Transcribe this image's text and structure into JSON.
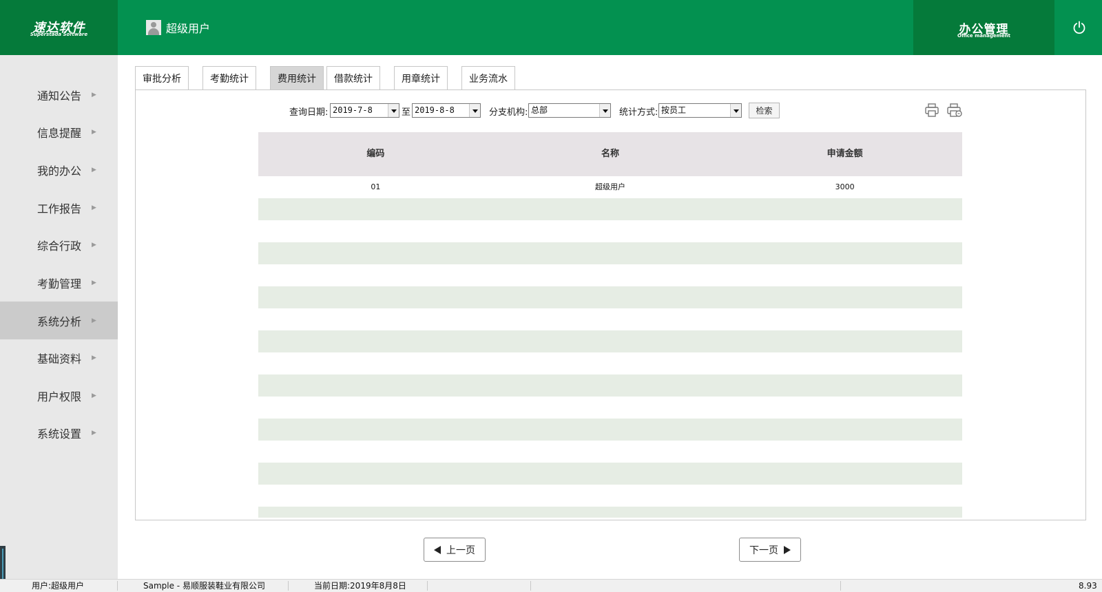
{
  "header": {
    "brand_name": "速达软件",
    "brand_subtitle": "Superstada Software",
    "current_user": "超级用户",
    "module_title": "办公管理",
    "module_subtitle": "Office management",
    "colors": {
      "header_green": "#039150",
      "dark_green": "#057a3a"
    }
  },
  "sidebar": {
    "items": [
      {
        "label": "通知公告"
      },
      {
        "label": "信息提醒"
      },
      {
        "label": "我的办公"
      },
      {
        "label": "工作报告"
      },
      {
        "label": "综合行政"
      },
      {
        "label": "考勤管理"
      },
      {
        "label": "系统分析",
        "active": true
      },
      {
        "label": "基础资料"
      },
      {
        "label": "用户权限"
      },
      {
        "label": "系统设置"
      }
    ]
  },
  "tabs": [
    {
      "label": "审批分析"
    },
    {
      "label": "考勤统计"
    },
    {
      "label": "费用统计",
      "active": true
    },
    {
      "label": "借款统计"
    },
    {
      "label": "用章统计"
    },
    {
      "label": "业务流水"
    }
  ],
  "filters": {
    "date_label": "查询日期:",
    "date_from": "2019-7-8",
    "date_sep": "至",
    "date_to": "2019-8-8",
    "branch_label": "分支机构:",
    "branch_value": "总部",
    "method_label": "统计方式:",
    "method_value": "按员工",
    "search_label": "检索"
  },
  "table": {
    "columns": [
      "编码",
      "名称",
      "申请金额"
    ],
    "rows": [
      [
        "01",
        "超级用户",
        "3000"
      ]
    ]
  },
  "pager": {
    "prev_label": "上一页",
    "next_label": "下一页"
  },
  "statusbar": {
    "user": "用户:超级用户",
    "company": "Sample - 易顺服装鞋业有限公司",
    "date": "当前日期:2019年8月8日",
    "version": "8.93"
  }
}
